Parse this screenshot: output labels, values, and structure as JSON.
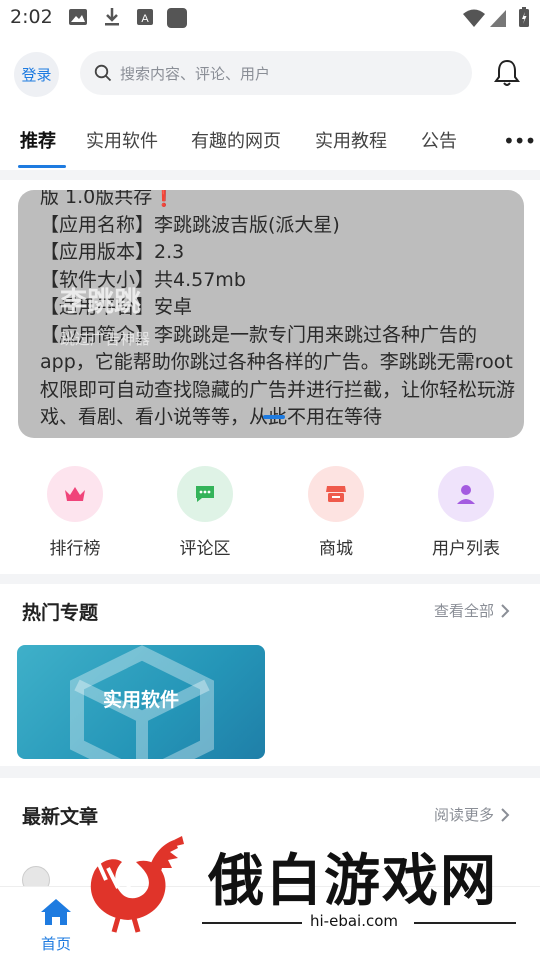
{
  "status_bar": {
    "time": "2:02"
  },
  "header": {
    "login_label": "登录",
    "search_placeholder": "搜索内容、评论、用户"
  },
  "tabs": {
    "items": [
      "推荐",
      "实用软件",
      "有趣的网页",
      "实用教程",
      "公告"
    ],
    "active": "推荐",
    "more": "•••"
  },
  "banner": {
    "lines": [
      "版 1.0版共存",
      "【应用名称】李跳跳波吉版(派大星)",
      "【应用版本】2.3",
      "【软件大小】共4.57mb",
      "【适用平台】安卓",
      "【应用简介】李跳跳是一款专门用来跳过各种广告的app，它能帮助你跳过各种各样的广告。李跳跳无需root权限即可自动查找隐藏的广告并进行拦截，让你轻松玩游戏、看剧、看小说等等，从此不用在等待"
    ],
    "warn_mark": "❗",
    "overlay_title": "李跳跳",
    "overlay_subtitle": "跳过广告神器"
  },
  "quick_actions": [
    {
      "label": "排行榜",
      "icon": "crown-icon",
      "bg": "#fde4ee",
      "color": "#f0447a"
    },
    {
      "label": "评论区",
      "icon": "chat-icon",
      "bg": "#dff3e6",
      "color": "#34b35a"
    },
    {
      "label": "商城",
      "icon": "shop-icon",
      "bg": "#fde3e1",
      "color": "#ef5a4b"
    },
    {
      "label": "用户列表",
      "icon": "user-icon",
      "bg": "#efe3fb",
      "color": "#a45be0"
    }
  ],
  "hot_topics": {
    "title": "热门专题",
    "more": "查看全部",
    "cards": [
      {
        "label": "实用软件"
      }
    ]
  },
  "latest": {
    "title": "最新文章",
    "more": "阅读更多"
  },
  "bottom_nav": {
    "home_label": "首页"
  },
  "watermark": {
    "text": "俄白游戏网",
    "url": "hi-ebai.com"
  },
  "colors": {
    "accent": "#1e7be0"
  }
}
